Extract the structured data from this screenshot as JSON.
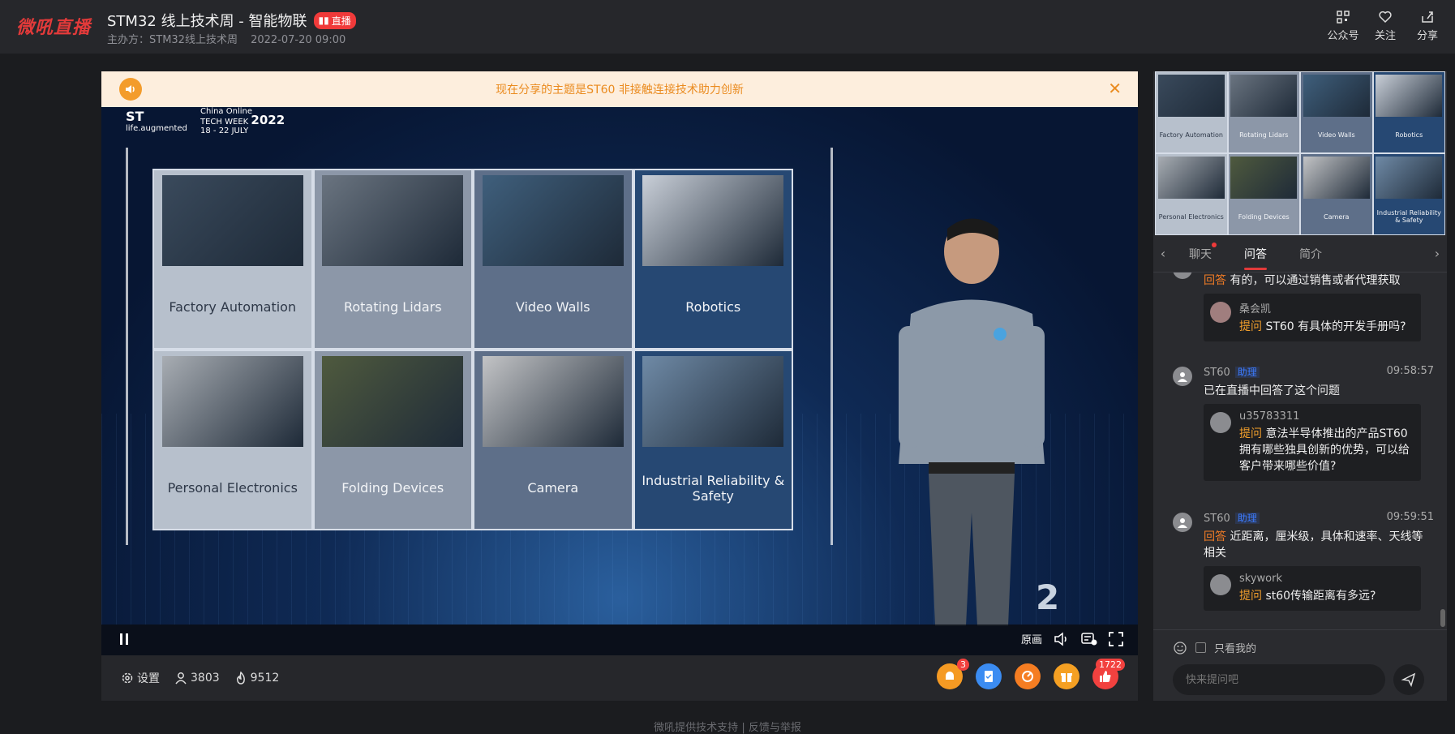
{
  "header": {
    "logo": "微吼直播",
    "title": "STM32 线上技术周 - 智能物联",
    "live_badge": "直播",
    "organizer": "主办方：STM32线上技术周",
    "datetime": "2022-07-20 09:00",
    "actions": [
      {
        "label": "公众号",
        "icon": "qrcode-icon"
      },
      {
        "label": "关注",
        "icon": "heart-plus-icon"
      },
      {
        "label": "分享",
        "icon": "share-icon"
      }
    ]
  },
  "player": {
    "notice": "现在分享的主题是ST60 非接触连接技术助力创新",
    "brand_tagline": "life.augmented",
    "event_line1": "China Online",
    "event_line2": "TECH WEEK",
    "event_year": "2022",
    "event_dates": "18 - 22 JULY",
    "slide_number": "2",
    "tiles": [
      {
        "label": "Factory Automation",
        "tone": "c0",
        "pic": "#3a4a5c"
      },
      {
        "label": "Rotating Lidars",
        "tone": "c1",
        "pic": "#6a7480"
      },
      {
        "label": "Video Walls",
        "tone": "c2",
        "pic": "#3f5f7c"
      },
      {
        "label": "Robotics",
        "tone": "c3",
        "pic": "#c9cfd8"
      },
      {
        "label": "Personal Electronics",
        "tone": "c0",
        "pic": "#a8adb3"
      },
      {
        "label": "Folding Devices",
        "tone": "c1",
        "pic": "#4f5a3e"
      },
      {
        "label": "Camera",
        "tone": "c2",
        "pic": "#c3c4c6"
      },
      {
        "label": "Industrial Reliability & Safety",
        "tone": "c3",
        "pic": "#6f8aa6"
      }
    ],
    "controls": {
      "quality": "原画"
    }
  },
  "bottom": {
    "settings": "设置",
    "viewers": "3803",
    "heat": "9512",
    "gifts": [
      {
        "icon": "bell-icon",
        "color": "#f59a23",
        "badge": "3"
      },
      {
        "icon": "survey-icon",
        "color": "#3b8cf2",
        "badge": ""
      },
      {
        "icon": "lottery-icon",
        "color": "#f57d22",
        "badge": ""
      },
      {
        "icon": "gift-icon",
        "color": "#f5a023",
        "badge": ""
      },
      {
        "icon": "like-icon",
        "color": "#f2413f",
        "badge": "1722"
      }
    ]
  },
  "footer": {
    "support": "微吼提供技术支持",
    "feedback": "反馈与举报"
  },
  "sidebar": {
    "thumbs": [
      {
        "label": "Factory Automation",
        "tone": "c0",
        "pic": "#3a4a5c"
      },
      {
        "label": "Rotating Lidars",
        "tone": "c1",
        "pic": "#6a7480"
      },
      {
        "label": "Video Walls",
        "tone": "c2",
        "pic": "#3f5f7c"
      },
      {
        "label": "Robotics",
        "tone": "c3",
        "pic": "#c9cfd8"
      },
      {
        "label": "Personal Electronics",
        "tone": "c0",
        "pic": "#a8adb3"
      },
      {
        "label": "Folding Devices",
        "tone": "c1",
        "pic": "#4f5a3e"
      },
      {
        "label": "Camera",
        "tone": "c2",
        "pic": "#c3c4c6"
      },
      {
        "label": "Industrial Reliability & Safety",
        "tone": "c3",
        "pic": "#6f8aa6"
      }
    ],
    "tabs": [
      {
        "label": "聊天",
        "dot": true
      },
      {
        "label": "问答",
        "active": true
      },
      {
        "label": "简介"
      }
    ],
    "feed": {
      "first_answer": {
        "tag": "回答",
        "text": " 有的，可以通过销售或者代理获取"
      },
      "first_quote": {
        "name": "桑会凯",
        "tag": "提问",
        "text": " ST60 有具体的开发手册吗?"
      },
      "msg2": {
        "name": "ST60",
        "role": "助理",
        "time": "09:58:57",
        "text": "已在直播中回答了这个问题",
        "quote_name": "u35783311",
        "quote_tag": "提问",
        "quote_text": " 意法半导体推出的产品ST60拥有哪些独具创新的优势，可以给客户带来哪些价值?"
      },
      "msg3": {
        "name": "ST60",
        "role": "助理",
        "time": "09:59:51",
        "tag": "回答",
        "text": " 近距离，厘米级，具体和速率、天线等相关",
        "quote_name": "skywork",
        "quote_tag": "提问",
        "quote_text": " st60传输距离有多远?"
      }
    },
    "only_mine": "只看我的",
    "input_placeholder": "快来提问吧"
  }
}
